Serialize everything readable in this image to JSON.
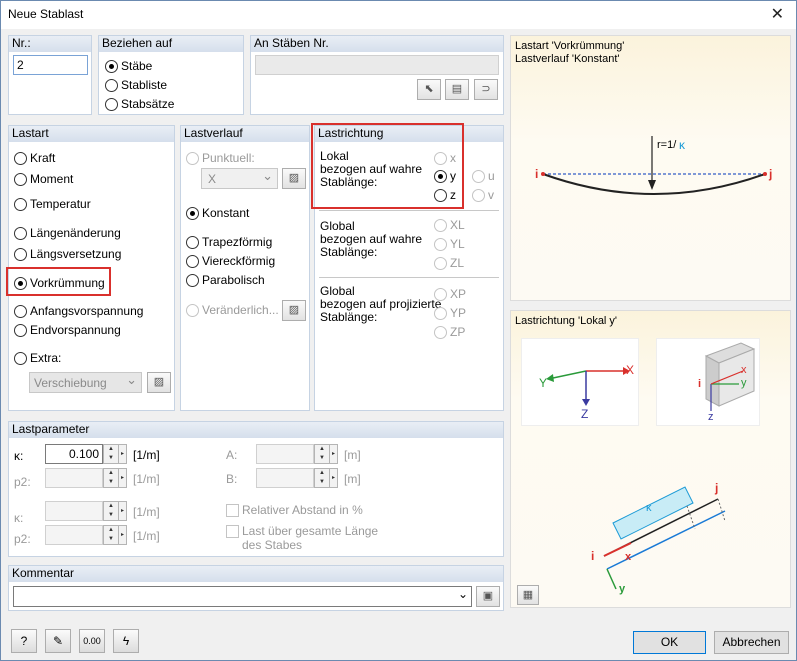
{
  "window": {
    "title": "Neue Stablast",
    "close_icon": "close-icon"
  },
  "nr": {
    "label": "Nr.:",
    "value": "2"
  },
  "beziehen": {
    "label": "Beziehen auf",
    "options": [
      "Stäbe",
      "Stabliste",
      "Stabsätze"
    ],
    "selected": 0
  },
  "staebe": {
    "label": "An Stäben Nr.",
    "value": ""
  },
  "lastart": {
    "label": "Lastart",
    "options": [
      "Kraft",
      "Moment",
      "Temperatur",
      "Längenänderung",
      "Längsversetzung",
      "Vorkrümmung",
      "Anfangsvorspannung",
      "Endvorspannung",
      "Extra:"
    ],
    "selected": 5,
    "extra_select": "Verschiebung"
  },
  "lastverlauf": {
    "label": "Lastverlauf",
    "punktuell": "Punktuell:",
    "punktuell_select": "X",
    "options": [
      "Konstant",
      "Trapezförmig",
      "Viereckförmig",
      "Parabolisch"
    ],
    "selected": 0,
    "veraenderlich": "Veränderlich..."
  },
  "lastrichtung": {
    "label": "Lastrichtung",
    "lokal": "Lokal\nbezogen auf wahre\nStablänge:",
    "lokal_opts": [
      "x",
      "y",
      "z"
    ],
    "lokal_extra": [
      "u",
      "v"
    ],
    "selected": "y",
    "global_wahr": "Global\nbezogen auf wahre\nStablänge:",
    "global_wahr_opts": [
      "XL",
      "YL",
      "ZL"
    ],
    "global_proj": "Global\nbezogen auf projizierte\nStablänge:",
    "global_proj_opts": [
      "XP",
      "YP",
      "ZP"
    ]
  },
  "lastparameter": {
    "label": "Lastparameter",
    "rows": [
      {
        "sym": "κ:",
        "value": "0.100",
        "unit": "[1/m]",
        "enabled": true
      },
      {
        "sym": "p2:",
        "value": "",
        "unit": "[1/m]",
        "enabled": false
      },
      {
        "sym": "κ:",
        "value": "",
        "unit": "[1/m]",
        "enabled": false
      },
      {
        "sym": "p2:",
        "value": "",
        "unit": "[1/m]",
        "enabled": false
      }
    ],
    "a_label": "A:",
    "b_label": "B:",
    "a_unit": "[m]",
    "b_unit": "[m]",
    "rel_abstand": "Relativer Abstand in %",
    "last_ueber": "Last über gesamte Länge",
    "des_stabes": "des Stabes"
  },
  "kommentar": {
    "label": "Kommentar",
    "value": ""
  },
  "preview_top": {
    "line1": "Lastart 'Vorkrümmung'",
    "line2": "Lastverlauf 'Konstant'",
    "r_label": "r=1/",
    "kappa": "κ",
    "i": "i",
    "j": "j"
  },
  "preview_bottom": {
    "title": "Lastrichtung 'Lokal y'",
    "Y": "Y",
    "X": "X",
    "Z": "Z",
    "x": "x",
    "y": "y",
    "z": "z",
    "i": "i",
    "j": "j",
    "kappa": "κ"
  },
  "buttons": {
    "ok": "OK",
    "cancel": "Abbrechen"
  },
  "colors": {
    "highlight": "#d9302c",
    "accent": "#0078d7"
  }
}
